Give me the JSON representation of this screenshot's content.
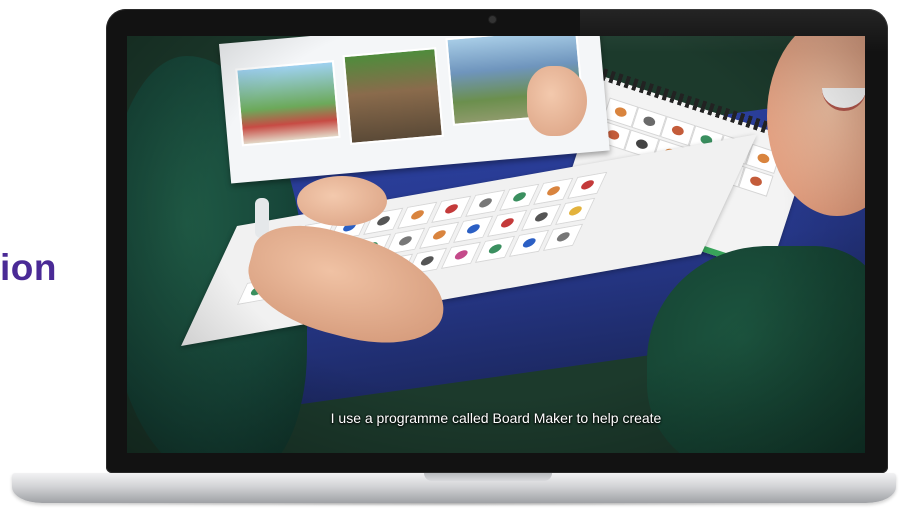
{
  "heading": {
    "text": "ion",
    "color": "#4a2a96"
  },
  "video": {
    "subtitle": "I use a programme called Board Maker to help create"
  },
  "colors": {
    "laptop_bezel": "#121212",
    "desk": "#2a3e9a",
    "uniform": "#17473a"
  },
  "icons": {
    "webcam": "webcam-dot-icon"
  }
}
